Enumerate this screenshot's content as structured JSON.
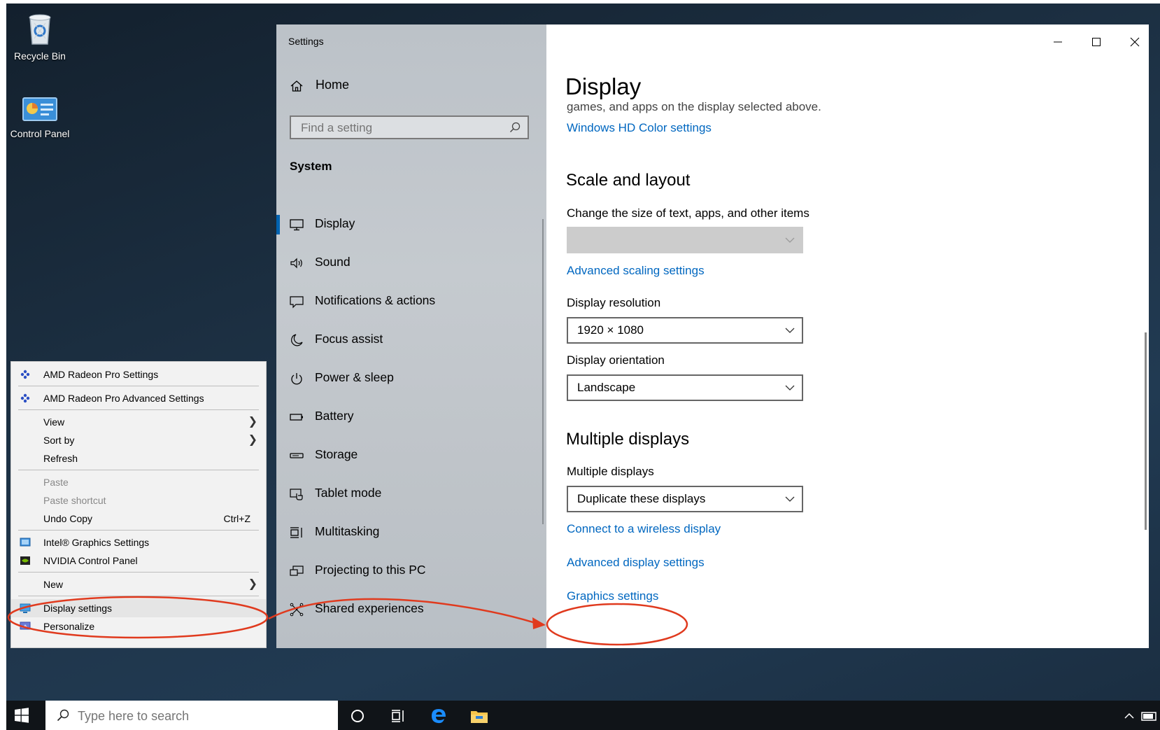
{
  "desktop": {
    "icons": [
      {
        "label": "Recycle Bin",
        "icon": "recycle-bin-icon"
      },
      {
        "label": "Control Panel",
        "icon": "control-panel-icon"
      }
    ]
  },
  "context_menu": {
    "items": [
      {
        "label": "AMD Radeon Pro Settings",
        "icon": "amd-radeon-icon"
      },
      {
        "label": "AMD Radeon Pro Advanced Settings",
        "icon": "amd-radeon-icon"
      },
      {
        "label": "View",
        "submenu": true
      },
      {
        "label": "Sort by",
        "submenu": true
      },
      {
        "label": "Refresh"
      },
      {
        "label": "Paste",
        "disabled": true
      },
      {
        "label": "Paste shortcut",
        "disabled": true
      },
      {
        "label": "Undo Copy",
        "shortcut": "Ctrl+Z"
      },
      {
        "label": "Intel® Graphics Settings",
        "icon": "intel-graphics-icon"
      },
      {
        "label": "NVIDIA Control Panel",
        "icon": "nvidia-icon"
      },
      {
        "label": "New",
        "submenu": true
      },
      {
        "label": "Display settings",
        "icon": "display-settings-icon",
        "highlighted": true
      },
      {
        "label": "Personalize",
        "icon": "personalize-icon"
      }
    ]
  },
  "settings": {
    "window_title": "Settings",
    "home_label": "Home",
    "search_placeholder": "Find a setting",
    "group_label": "System",
    "nav_items": [
      {
        "label": "Display",
        "icon": "monitor-icon",
        "selected": true
      },
      {
        "label": "Sound",
        "icon": "speaker-icon"
      },
      {
        "label": "Notifications & actions",
        "icon": "notification-icon"
      },
      {
        "label": "Focus assist",
        "icon": "moon-icon"
      },
      {
        "label": "Power & sleep",
        "icon": "power-icon"
      },
      {
        "label": "Battery",
        "icon": "battery-icon"
      },
      {
        "label": "Storage",
        "icon": "storage-icon"
      },
      {
        "label": "Tablet mode",
        "icon": "tablet-mode-icon"
      },
      {
        "label": "Multitasking",
        "icon": "multitasking-icon"
      },
      {
        "label": "Projecting to this PC",
        "icon": "projecting-icon"
      },
      {
        "label": "Shared experiences",
        "icon": "shared-experiences-icon"
      }
    ],
    "content": {
      "page_title": "Display",
      "hdr_description_tail": "games, and apps on the display selected above.",
      "hdr_link": "Windows HD Color settings",
      "scale_heading": "Scale and layout",
      "scale_label": "Change the size of text, apps, and other items",
      "scale_value": "",
      "advanced_scaling_link": "Advanced scaling settings",
      "resolution_label": "Display resolution",
      "resolution_value": "1920 × 1080",
      "orientation_label": "Display orientation",
      "orientation_value": "Landscape",
      "multi_heading": "Multiple displays",
      "multi_label": "Multiple displays",
      "multi_value": "Duplicate these displays",
      "wireless_link": "Connect to a wireless display",
      "advanced_display_link": "Advanced display settings",
      "graphics_link": "Graphics settings"
    }
  },
  "taskbar": {
    "search_placeholder": "Type here to search"
  },
  "colors": {
    "accent": "#0067c0",
    "annotation": "#e03a1e",
    "nav_bg": "#c0c5ca",
    "taskbar": "#101418"
  }
}
